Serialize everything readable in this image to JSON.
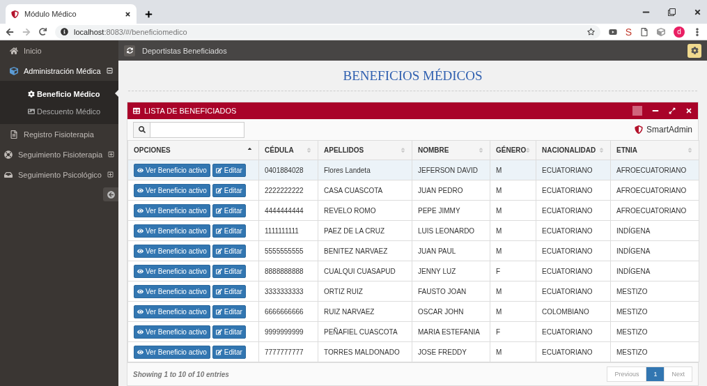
{
  "browser": {
    "tab_title": "Módulo Médico",
    "url_host": "localhost",
    "url_path": ":8083/#/beneficiomedico",
    "extension_letter": "S",
    "profile_letter": "d"
  },
  "header": {
    "title": "Deportistas Beneficiados"
  },
  "sidebar": {
    "items": [
      {
        "label": "Inicio"
      },
      {
        "label": "Administración Médica",
        "expanded": true,
        "children": [
          {
            "label": "Beneficio Médico",
            "selected": true
          },
          {
            "label": "Descuento Médico",
            "selected": false
          }
        ]
      },
      {
        "label": "Registro Fisioterapia"
      },
      {
        "label": "Seguimiento Fisioterapia",
        "expanded": false
      },
      {
        "label": "Seguimiento Psicológico",
        "expanded": false
      }
    ]
  },
  "page_title": "BENEFICIOS MÉDICOS",
  "widget": {
    "title": "LISTA DE BENEFICIADOS",
    "brand": "SmartAdmin",
    "columns": [
      {
        "label": "OPCIONES",
        "sorted": true
      },
      {
        "label": "CÉDULA",
        "sorted": false
      },
      {
        "label": "APELLIDOS",
        "sorted": false
      },
      {
        "label": "NOMBRE",
        "sorted": false
      },
      {
        "label": "GÉNERO",
        "sorted": false
      },
      {
        "label": "NACIONALIDAD",
        "sorted": false
      },
      {
        "label": "ETNIA",
        "sorted": false
      }
    ],
    "rows": [
      {
        "highlighted": true,
        "cells": [
          {
            "buttons": [
              "Ver Beneficio activo",
              "Editar"
            ]
          },
          "0401884028",
          "Flores Landeta",
          "JEFERSON DAVID",
          "M",
          "ECUATORIANO",
          "AFROECUATORIANO"
        ]
      },
      {
        "highlighted": false,
        "cells": [
          {
            "buttons": [
              "Ver Beneficio activo",
              "Editar"
            ]
          },
          "2222222222",
          "CASA CUASCOTA",
          "JUAN PEDRO",
          "M",
          "ECUATORIANO",
          "AFROECUATORIANO"
        ]
      },
      {
        "highlighted": false,
        "cells": [
          {
            "buttons": [
              "Ver Beneficio activo",
              "Editar"
            ]
          },
          "4444444444",
          "REVELO ROMO",
          "PEPE JIMMY",
          "M",
          "ECUATORIANO",
          "AFROECUATORIANO"
        ]
      },
      {
        "highlighted": false,
        "cells": [
          {
            "buttons": [
              "Ver Beneficio activo",
              "Editar"
            ]
          },
          "1111111111",
          "PAEZ DE LA CRUZ",
          "LUIS LEONARDO",
          "M",
          "ECUATORIANO",
          "INDÍGENA"
        ]
      },
      {
        "highlighted": false,
        "cells": [
          {
            "buttons": [
              "Ver Beneficio activo",
              "Editar"
            ]
          },
          "5555555555",
          "BENITEZ NARVAEZ",
          "JUAN PAUL",
          "M",
          "ECUATORIANO",
          "INDÍGENA"
        ]
      },
      {
        "highlighted": false,
        "cells": [
          {
            "buttons": [
              "Ver Beneficio activo",
              "Editar"
            ]
          },
          "8888888888",
          "CUALQUI CUASAPUD",
          "JENNY LUZ",
          "F",
          "ECUATORIANO",
          "INDÍGENA"
        ]
      },
      {
        "highlighted": false,
        "cells": [
          {
            "buttons": [
              "Ver Beneficio activo",
              "Editar"
            ]
          },
          "3333333333",
          "ORTIZ RUIZ",
          "FAUSTO JOAN",
          "M",
          "ECUATORIANO",
          "MESTIZO"
        ]
      },
      {
        "highlighted": false,
        "cells": [
          {
            "buttons": [
              "Ver Beneficio activo",
              "Editar"
            ]
          },
          "6666666666",
          "RUIZ NARVAEZ",
          "OSCAR JOHN",
          "M",
          "COLOMBIANO",
          "MESTIZO"
        ]
      },
      {
        "highlighted": false,
        "cells": [
          {
            "buttons": [
              "Ver Beneficio activo",
              "Editar"
            ]
          },
          "9999999999",
          "PEÑAFIEL CUASCOTA",
          "MARIA ESTEFANIA",
          "F",
          "ECUATORIANO",
          "MESTIZO"
        ]
      },
      {
        "highlighted": false,
        "cells": [
          {
            "buttons": [
              "Ver Beneficio activo",
              "Editar"
            ]
          },
          "7777777777",
          "TORRES MALDONADO",
          "JOSE FREDDY",
          "M",
          "ECUATORIANO",
          "MESTIZO"
        ]
      }
    ],
    "footer_info": "Showing 1 to 10 of 10 entries",
    "pagination": [
      {
        "label": "Previous",
        "selected": false
      },
      {
        "label": "1",
        "selected": true
      },
      {
        "label": "Next",
        "selected": false
      }
    ]
  }
}
